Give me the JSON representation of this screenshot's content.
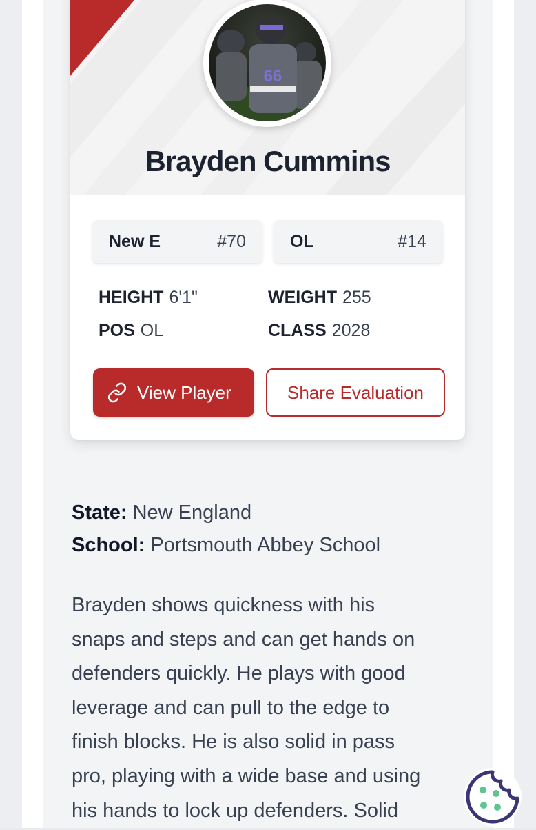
{
  "player": {
    "name": "Brayden Cummins",
    "photo_jersey": "66",
    "team_chip": {
      "label": "New E",
      "rank": "#70"
    },
    "position_chip": {
      "label": "OL",
      "rank": "#14"
    },
    "stats": {
      "height": {
        "label": "HEIGHT",
        "value": "6'1\""
      },
      "weight": {
        "label": "WEIGHT",
        "value": "255"
      },
      "pos": {
        "label": "POS",
        "value": "OL"
      },
      "class": {
        "label": "CLASS",
        "value": "2028"
      }
    }
  },
  "actions": {
    "view_player": "View Player",
    "share_evaluation": "Share Evaluation"
  },
  "details": {
    "state": {
      "label": "State:",
      "value": "New England"
    },
    "school": {
      "label": "School:",
      "value": "Portsmouth Abbey School"
    }
  },
  "bio_lines": [
    "Brayden shows quickness with his",
    "snaps and steps and can get hands on",
    "defenders quickly. He plays with good",
    "leverage and can pull to the edge to",
    "finish blocks. He is also solid in pass",
    "pro, playing with a wide base and using",
    "his hands to lock up defenders. Solid"
  ],
  "icons": {
    "link": "link-icon",
    "cookie": "cookie-icon"
  },
  "colors": {
    "accent": "#b92a2a",
    "text_dark": "#1c2230",
    "cookie": "#3b3575",
    "cookie_dots": "#5fc48f"
  }
}
